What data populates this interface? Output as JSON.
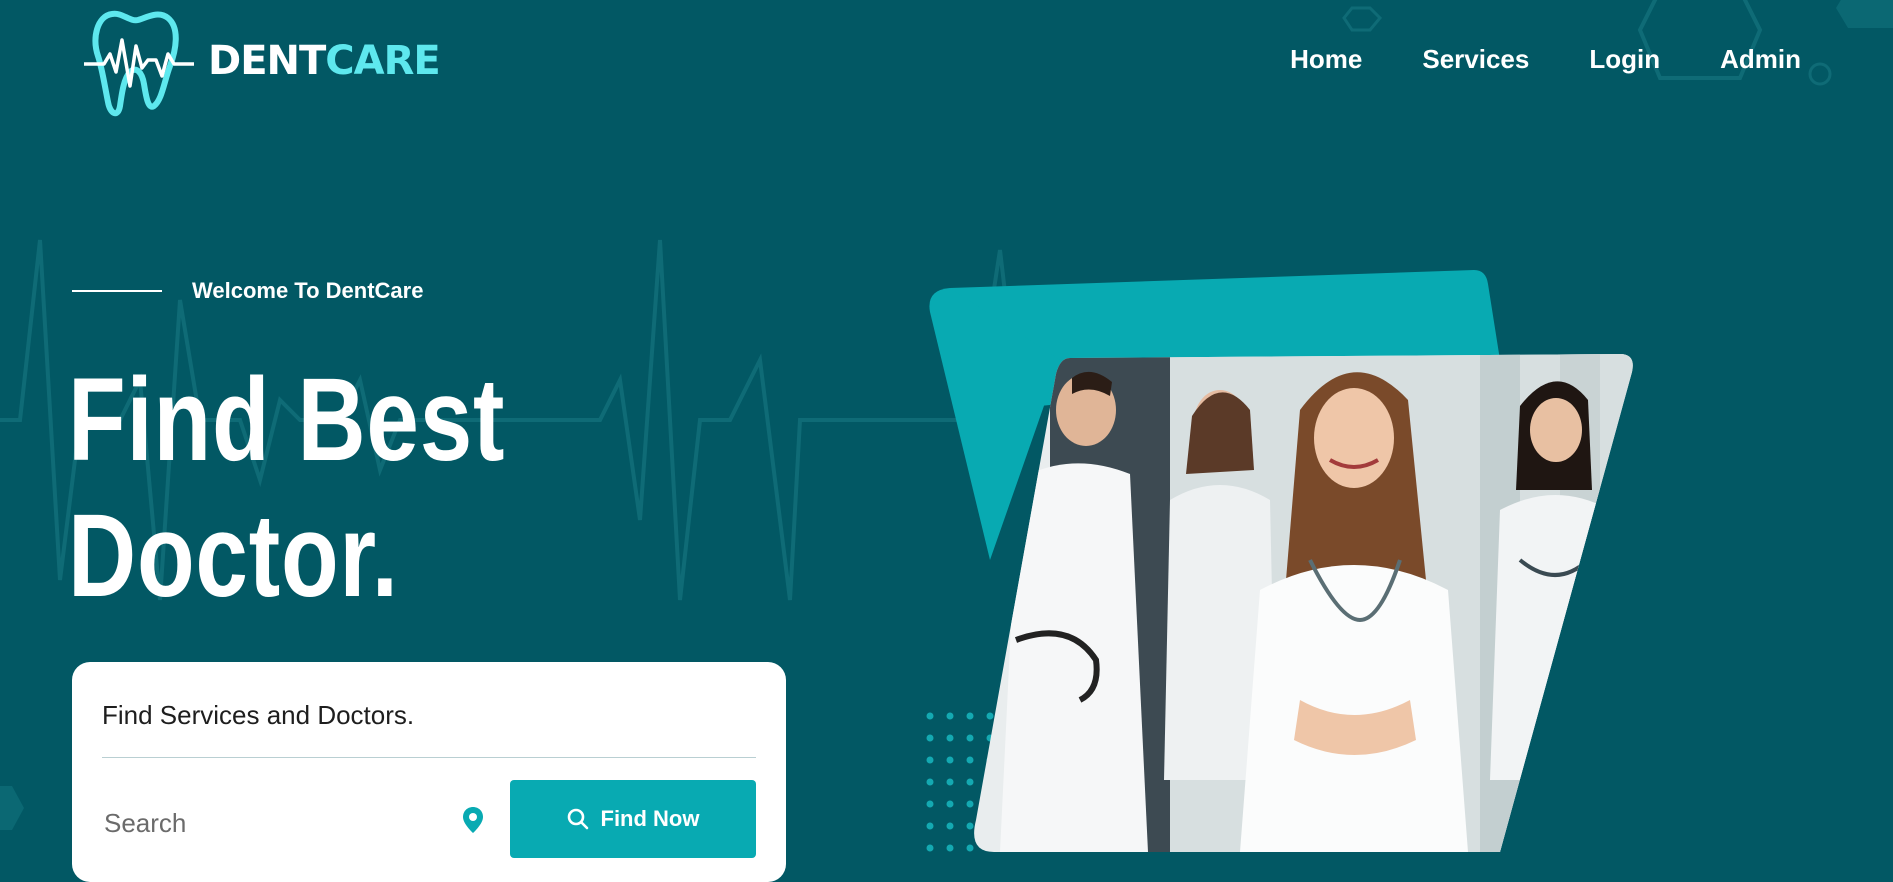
{
  "brand": {
    "name_part1": "DENT",
    "name_part2": "CARE"
  },
  "nav": {
    "items": [
      {
        "label": "Home"
      },
      {
        "label": "Services"
      },
      {
        "label": "Login"
      },
      {
        "label": "Admin"
      }
    ]
  },
  "hero": {
    "eyebrow": "Welcome To DentCare",
    "title_line1": "Find Best",
    "title_line2": "Doctor."
  },
  "search": {
    "heading": "Find Services and Doctors.",
    "placeholder": "Search",
    "button_label": "Find Now"
  },
  "icons": {
    "location": "map-pin-icon",
    "search": "search-icon",
    "logo": "tooth-heartbeat-logo"
  },
  "colors": {
    "background": "#025864",
    "accent": "#08aab2",
    "brand_secondary": "#5ee8ee",
    "card": "#ffffff"
  }
}
